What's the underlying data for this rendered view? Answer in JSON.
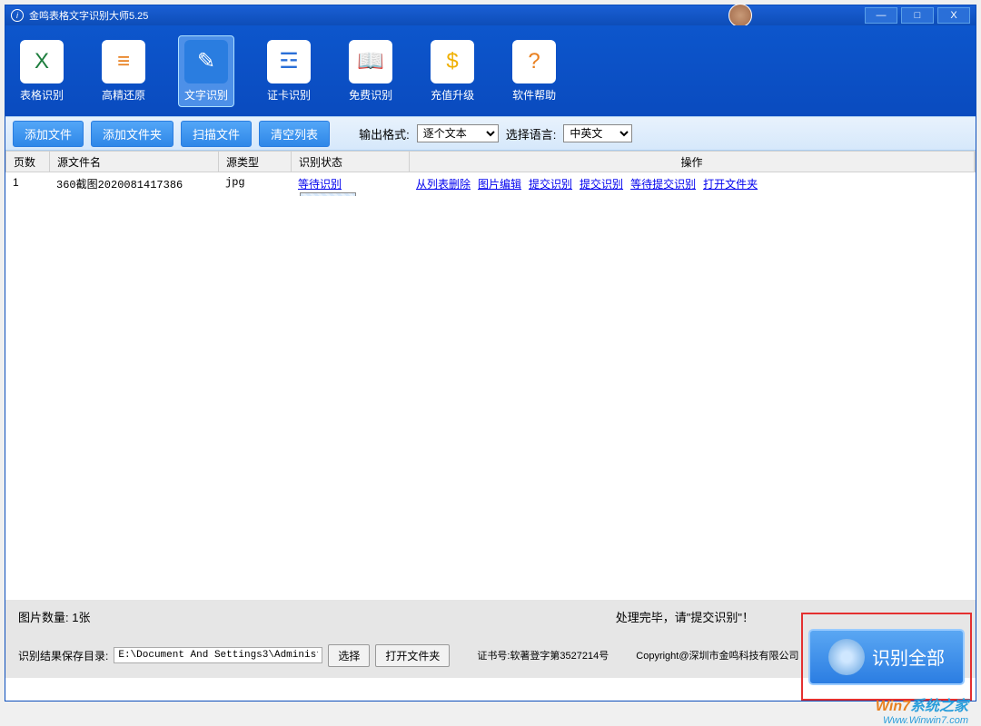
{
  "titlebar": {
    "title": "金鸣表格文字识别大师5.25"
  },
  "toolbar": [
    {
      "label": "表格识别",
      "icon": "X",
      "color": "#1e7e3e"
    },
    {
      "label": "高精还原",
      "icon": "≡",
      "color": "#e88020"
    },
    {
      "label": "文字识别",
      "icon": "✎",
      "color": "#fff",
      "active": true
    },
    {
      "label": "证卡识别",
      "icon": "☲",
      "color": "#2a6fd8"
    },
    {
      "label": "免费识别",
      "icon": "📖",
      "color": "#e88020"
    },
    {
      "label": "充值升级",
      "icon": "$",
      "color": "#f0b000"
    },
    {
      "label": "软件帮助",
      "icon": "?",
      "color": "#e98020"
    }
  ],
  "second": {
    "add_file": "添加文件",
    "add_folder": "添加文件夹",
    "scan_file": "扫描文件",
    "clear_list": "清空列表",
    "out_fmt_label": "输出格式:",
    "out_fmt_value": "逐个文本",
    "lang_label": "选择语言:",
    "lang_value": "中英文"
  },
  "table": {
    "headers": {
      "page": "页数",
      "file": "源文件名",
      "type": "源类型",
      "status": "识别状态",
      "ops": "操作"
    },
    "rows": [
      {
        "page": "1",
        "file": "360截图2020081417386",
        "type": "jpg",
        "status": "等待识别",
        "ops": [
          "从列表删除",
          "图片编辑",
          "提交识别",
          "提交识别",
          "等待提交识别",
          "打开文件夹"
        ]
      }
    ]
  },
  "status": {
    "count": "图片数量: 1张",
    "done_msg": "处理完毕，请\"提交识别\"！",
    "save_label": "识别结果保存目录:",
    "save_path": "E:\\Document And Settings3\\Administ",
    "browse": "选择",
    "open_folder": "打开文件夹",
    "cert": "证书号:软著登字第3527214号",
    "copyright": "Copyright@深圳市金鸣科技有限公司",
    "bigbtn": "识别全部"
  },
  "watermark": {
    "line1_a": "Win7",
    "line1_b": "系统之家",
    "line2": "Www.Winwin7.com"
  }
}
